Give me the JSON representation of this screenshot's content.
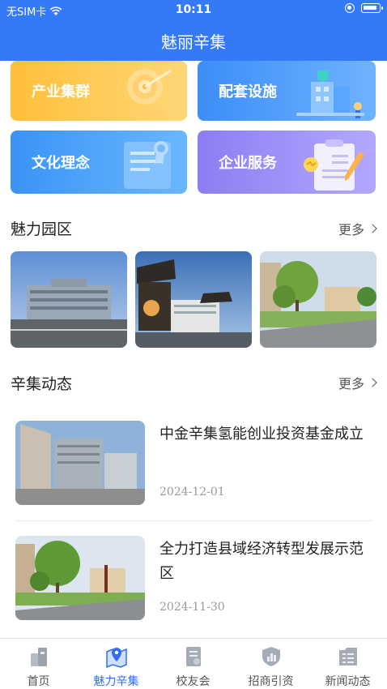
{
  "status": {
    "carrier": "无SIM卡",
    "time": "10:11"
  },
  "header": {
    "title": "魅丽辛集"
  },
  "cards": [
    {
      "label": "产业集群",
      "icon": "target-icon"
    },
    {
      "label": "配套设施",
      "icon": "building-icon"
    },
    {
      "label": "文化理念",
      "icon": "certificate-icon"
    },
    {
      "label": "企业服务",
      "icon": "clipboard-icon"
    }
  ],
  "park": {
    "title": "魅力园区",
    "more": "更多"
  },
  "news_section": {
    "title": "辛集动态",
    "more": "更多"
  },
  "news": [
    {
      "title": "中金辛集氢能创业投资基金成立",
      "date": "2024-12-01"
    },
    {
      "title": "全力打造县域经济转型发展示范区",
      "date": "2024-11-30"
    }
  ],
  "tabs": [
    {
      "label": "首页",
      "icon": "home-icon"
    },
    {
      "label": "魅力辛集",
      "icon": "map-pin-icon",
      "active": true
    },
    {
      "label": "校友会",
      "icon": "document-icon"
    },
    {
      "label": "招商引资",
      "icon": "chart-shield-icon"
    },
    {
      "label": "新闻动态",
      "icon": "news-icon"
    }
  ],
  "colors": {
    "primary": "#3479f6",
    "active_tab": "#2f6ef0"
  }
}
